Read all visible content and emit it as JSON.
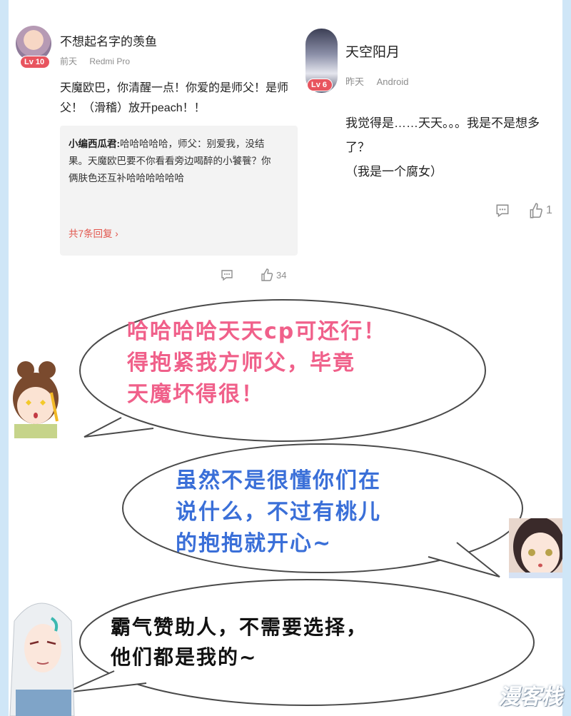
{
  "comment_left": {
    "username": "不想起名字的羡鱼",
    "level": "Lv 10",
    "time": "前天",
    "device": "Redmi Pro",
    "text_line1": "天魔欧巴，你清醒一点！你爱的是师父！是师",
    "text_line2": "父！（滑稽）放开peach！！",
    "reply": {
      "author": "小编西瓜君:",
      "text_line1": "哈哈哈哈哈，师父：别爱我，没结",
      "text_line2": "果。天魔欧巴要不你看看旁边喝醉的小饕餮？你",
      "text_line3": "俩肤色还互补哈哈哈哈哈哈",
      "more": "共7条回复"
    },
    "likes": "34"
  },
  "comment_right": {
    "username": "天空阳月",
    "level": "Lv 6",
    "time": "昨天",
    "device": "Android",
    "text_line1": "我觉得是……天天。。。我是不是想多了？",
    "text_line2": "（我是一个腐女）",
    "likes": "1"
  },
  "bubbles": [
    {
      "line1": "哈哈哈哈天天cp可还行！",
      "line2": "得抱紧我方师父，毕竟",
      "line3": "天魔坏得很！",
      "color": "#f0608a"
    },
    {
      "line1": "虽然不是很懂你们在",
      "line2": "说什么，不过有桃儿",
      "line3": "的抱抱就开心~",
      "color": "#3a6fd8"
    },
    {
      "line1": "霸气赞助人，不需要选择，",
      "line2": "他们都是我的~",
      "color": "#111111"
    }
  ],
  "watermark": "漫客栈",
  "colors": {
    "badge": "#e8555f",
    "reply_more": "#e2564d",
    "background": "#cfe6f7"
  }
}
